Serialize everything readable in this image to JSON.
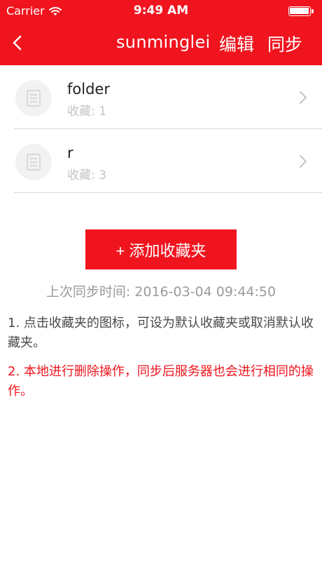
{
  "status_bar": {
    "carrier": "Carrier",
    "time": "9:49 AM"
  },
  "nav": {
    "title": "sunminglei",
    "edit_label": "编辑",
    "sync_label": "同步"
  },
  "folders": [
    {
      "name": "folder",
      "count_text": "收藏: 1"
    },
    {
      "name": "r",
      "count_text": "收藏: 3"
    }
  ],
  "add_button_label": "+ 添加收藏夹",
  "sync_info": {
    "label": "上次同步时间:",
    "value": "2016-03-04 09:44:50"
  },
  "notes": [
    "1. 点击收藏夹的图标，可设为默认收藏夹或取消默认收藏夹。",
    "2. 本地进行删除操作，同步后服务器也会进行相同的操作。"
  ],
  "colors": {
    "brand_red": "#f0141e",
    "muted_text": "#9a9a9a",
    "divider": "#d9d9d9"
  },
  "icons": [
    "wifi-icon",
    "battery-icon",
    "back-chevron-icon",
    "list-icon",
    "chevron-right-icon"
  ]
}
